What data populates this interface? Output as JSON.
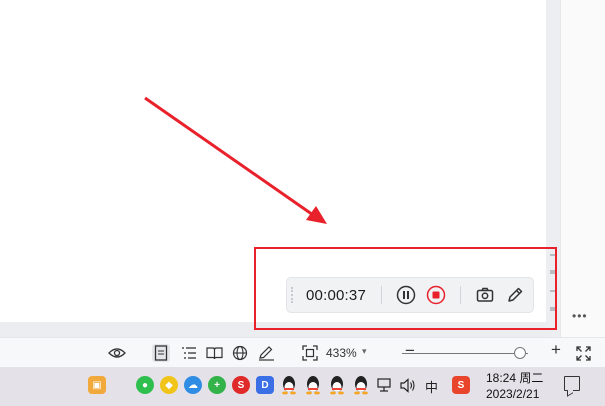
{
  "recorder": {
    "elapsed_time": "00:00:37",
    "pause_icon": "pause-circle-icon",
    "stop_icon": "stop-record-icon",
    "screenshot_icon": "camera-icon",
    "annotate_icon": "pen-icon"
  },
  "status_bar": {
    "zoom_percent": "433%",
    "zoom_level": 0.94,
    "icons": [
      "eye-icon",
      "page-view-icon",
      "outline-view-icon",
      "reading-view-icon",
      "web-view-icon",
      "write-view-icon",
      "fit-page-icon",
      "fullscreen-icon"
    ]
  },
  "taskbar": {
    "time": "18:24 周二",
    "date": "2023/2/21",
    "ime_label": "中"
  },
  "colors": {
    "annotation_red": "#e8212b",
    "stop_red": "#e8212b"
  }
}
